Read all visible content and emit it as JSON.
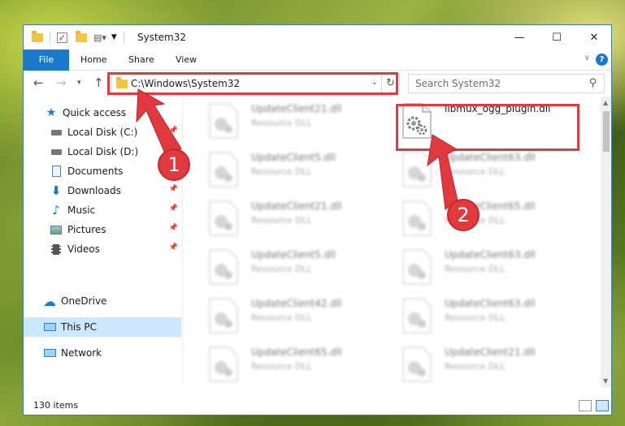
{
  "window": {
    "title": "System32",
    "minimize_glyph": "—",
    "maximize_glyph": "☐",
    "close_glyph": "✕"
  },
  "ribbon": {
    "tabs": [
      "File",
      "Home",
      "Share",
      "View"
    ],
    "help_glyph": "?",
    "collapse_glyph": "∨"
  },
  "address": {
    "path": "C:\\Windows\\System32",
    "search_placeholder": "Search System32"
  },
  "sidebar": {
    "items": [
      {
        "label": "Quick access",
        "icon": "star-icon",
        "pinned": false
      },
      {
        "label": "Local Disk (C:)",
        "icon": "drive-icon",
        "pinned": true
      },
      {
        "label": "Local Disk (D:)",
        "icon": "drive-icon",
        "pinned": true
      },
      {
        "label": "Documents",
        "icon": "document-icon",
        "pinned": true
      },
      {
        "label": "Downloads",
        "icon": "download-icon",
        "pinned": true
      },
      {
        "label": "Music",
        "icon": "music-icon",
        "pinned": true
      },
      {
        "label": "Pictures",
        "icon": "pictures-icon",
        "pinned": true
      },
      {
        "label": "Videos",
        "icon": "video-icon",
        "pinned": true
      },
      {
        "label": "OneDrive",
        "icon": "cloud-icon",
        "pinned": false
      },
      {
        "label": "This PC",
        "icon": "computer-icon",
        "pinned": false,
        "selected": true
      },
      {
        "label": "Network",
        "icon": "network-icon",
        "pinned": false
      }
    ]
  },
  "files": {
    "left_column": [
      {
        "name": "UpdateClient21.dll",
        "type": "Resource DLL"
      },
      {
        "name": "UpdateClient5.dll",
        "type": "Resource DLL"
      },
      {
        "name": "UpdateClient21.dll",
        "type": "Resource DLL"
      },
      {
        "name": "UpdateClient5.dll",
        "type": "Resource DLL"
      },
      {
        "name": "UpdateClient42.dll",
        "type": "Resource DLL"
      },
      {
        "name": "UpdateClient65.dll",
        "type": "Resource DLL"
      }
    ],
    "right_column": [
      {
        "name": "libmux_ogg_plugin.dll",
        "type": "",
        "highlighted": true
      },
      {
        "name": "UpdateClient63.dll",
        "type": "Resource DLL"
      },
      {
        "name": "UpdateClient65.dll",
        "type": "Resource DLL"
      },
      {
        "name": "UpdateClient63.dll",
        "type": "Resource DLL"
      },
      {
        "name": "UpdateClient63.dll",
        "type": "Resource DLL"
      },
      {
        "name": "UpdateClient21.dll",
        "type": "Resource DLL"
      }
    ]
  },
  "status": {
    "item_count": "130 items"
  },
  "callouts": [
    "1",
    "2"
  ],
  "colors": {
    "accent": "#1979ca",
    "highlight_red": "#e0393e",
    "selected_bg": "#cce8ff"
  }
}
